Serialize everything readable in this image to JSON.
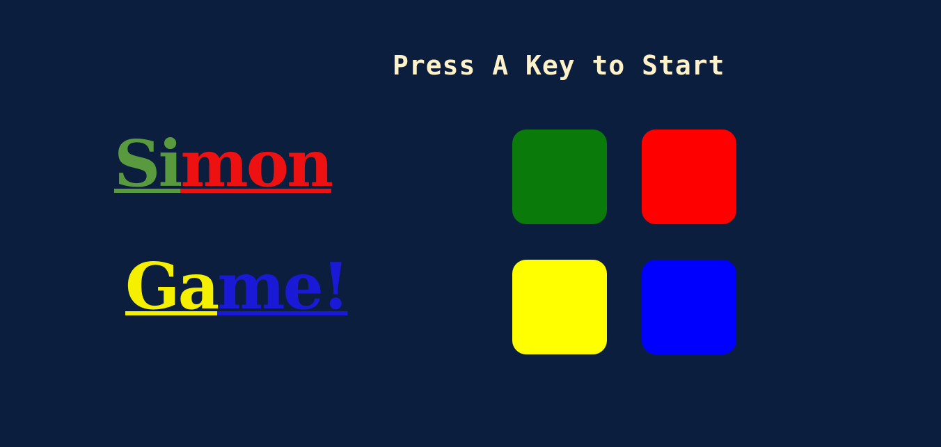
{
  "status": {
    "message": "Press A Key to Start"
  },
  "title": {
    "line1": [
      {
        "text": "Si",
        "color": "#5a9a3e"
      },
      {
        "text": "mon",
        "color": "#ee1111"
      }
    ],
    "line2": [
      {
        "text": "Ga",
        "color": "#f4f000"
      },
      {
        "text": "me!",
        "color": "#1a1ad6"
      }
    ]
  },
  "pads": [
    {
      "name": "green",
      "color": "#0a7a0a"
    },
    {
      "name": "red",
      "color": "#ff0000"
    },
    {
      "name": "yellow",
      "color": "#ffff00"
    },
    {
      "name": "blue",
      "color": "#0000ff"
    }
  ]
}
